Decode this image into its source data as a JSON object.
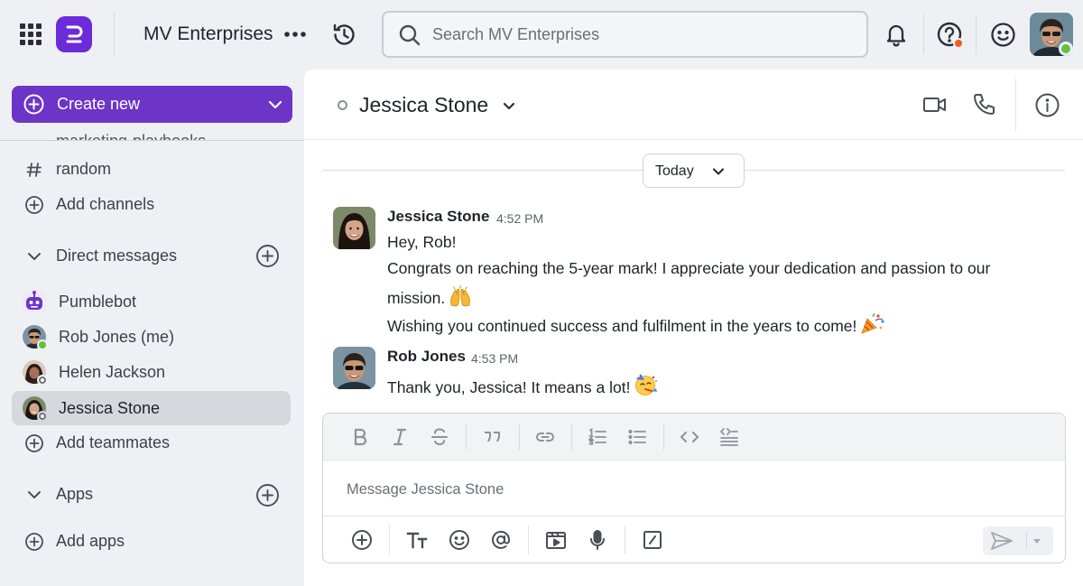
{
  "topbar": {
    "workspace_name": "MV Enterprises",
    "search_placeholder": "Search MV Enterprises"
  },
  "sidebar": {
    "create_label": "Create new",
    "cut_item": "marketing-playbooks",
    "channels": [
      {
        "label": "random",
        "icon": "hash-icon"
      },
      {
        "label": "Add channels",
        "icon": "plus-circle-icon"
      }
    ],
    "dm_section": "Direct messages",
    "dms": [
      {
        "label": "Pumblebot",
        "status": "bot"
      },
      {
        "label": "Rob Jones (me)",
        "status": "online"
      },
      {
        "label": "Helen Jackson",
        "status": "offline"
      },
      {
        "label": "Jessica Stone",
        "status": "offline",
        "active": true
      }
    ],
    "add_teammates": "Add teammates",
    "apps_section": "Apps",
    "add_apps": "Add apps"
  },
  "channel": {
    "title": "Jessica Stone",
    "day_label": "Today"
  },
  "messages": [
    {
      "author": "Jessica Stone",
      "time": "4:52 PM",
      "lines": [
        "Hey, Rob!",
        "Congrats on reaching the 5-year mark! I appreciate your dedication and passion to our",
        "mission.",
        "Wishing you continued success and fulfilment in the years to come!"
      ],
      "emojis": [
        "raising-hands-emoji",
        "party-popper-emoji"
      ]
    },
    {
      "author": "Rob Jones",
      "time": "4:53 PM",
      "lines": [
        "Thank you, Jessica! It means a lot!"
      ],
      "emojis": [
        "partying-face-emoji"
      ]
    }
  ],
  "composer": {
    "placeholder": "Message Jessica Stone"
  },
  "colors": {
    "brand": "#6c35c8",
    "online": "#63c23e",
    "alert": "#f45b1f"
  }
}
